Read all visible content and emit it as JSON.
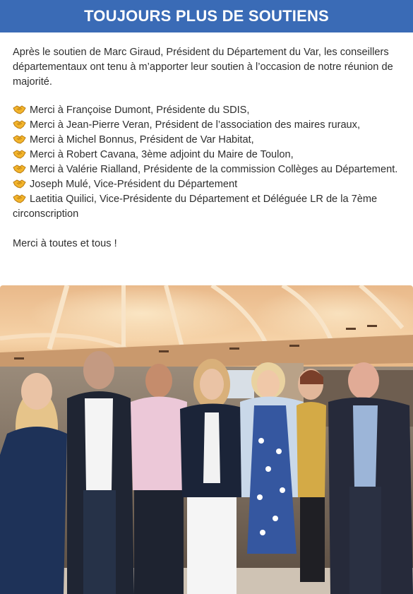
{
  "header": {
    "title": "TOUJOURS PLUS DE SOUTIENS",
    "background_color": "#3a6bb6"
  },
  "intro": "Après le soutien de Marc Giraud, Président du Département du Var, les conseillers départementaux ont tenu à m’apporter leur soutien à l’occasion de notre réunion de majorité.",
  "thanks": [
    {
      "icon": "handshake-icon",
      "text": "Merci à Françoise Dumont, Présidente du SDIS,"
    },
    {
      "icon": "handshake-icon",
      "text": "Merci à Jean-Pierre Veran, Président de l’association des maires ruraux,"
    },
    {
      "icon": "handshake-icon",
      "text": "Merci à Michel Bonnus, Président de Var Habitat,"
    },
    {
      "icon": "handshake-icon",
      "text": "Merci à Robert Cavana, 3ème adjoint du Maire de Toulon,"
    },
    {
      "icon": "handshake-icon",
      "text": "Merci à Valérie Rialland, Présidente de la commission Collèges au Département."
    },
    {
      "icon": "handshake-icon",
      "text": "Joseph Mulé, Vice-Président du Département"
    },
    {
      "icon": "handshake-icon",
      "text": "Laetitia Quilici, Vice-Présidente du Département et Déléguée LR de la 7ème circonscription"
    }
  ],
  "closing": "Merci à toutes et tous !",
  "photo": {
    "icon": "group-photo"
  }
}
